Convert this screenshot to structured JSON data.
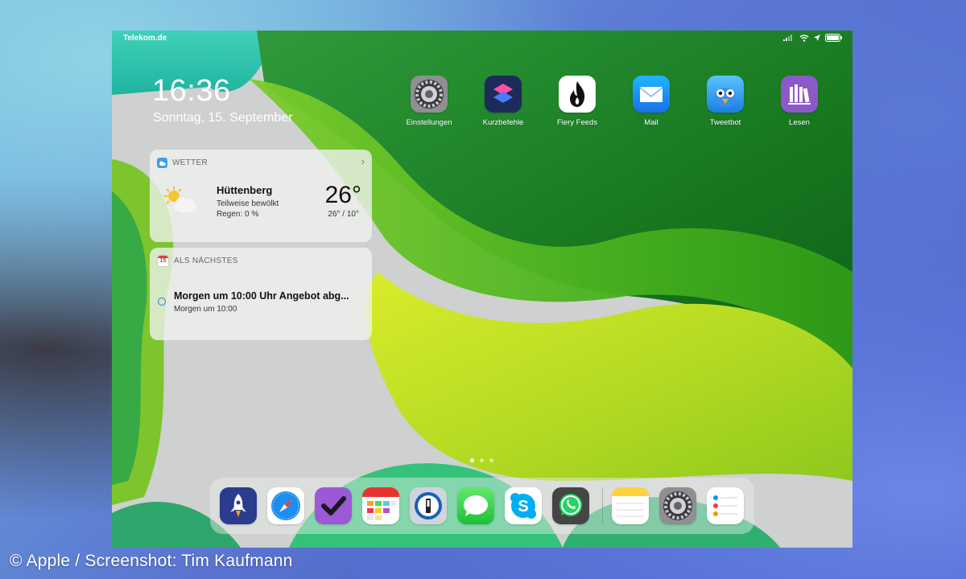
{
  "credit": "© Apple / Screenshot: Tim Kaufmann",
  "statusbar": {
    "carrier": "Telekom.de"
  },
  "lockinfo": {
    "time": "16:36",
    "date": "Sonntag, 15. September"
  },
  "weather": {
    "header": "WETTER",
    "city": "Hüttenberg",
    "condition": "Teilweise bewölkt",
    "rain": "Regen: 0 %",
    "temp": "26°",
    "range": "26° / 10°"
  },
  "upnext": {
    "header": "ALS NÄCHSTES",
    "calendar_day": "15",
    "event_title": "Morgen um 10:00 Uhr Angebot abg...",
    "event_time": "Morgen um 10:00"
  },
  "apps": [
    {
      "label": "Einstellungen",
      "icon": "settings-icon"
    },
    {
      "label": "Kurzbefehle",
      "icon": "shortcuts-icon"
    },
    {
      "label": "Fiery Feeds",
      "icon": "flame-icon"
    },
    {
      "label": "Mail",
      "icon": "mail-icon"
    },
    {
      "label": "Tweetbot",
      "icon": "tweetbot-icon"
    },
    {
      "label": "Lesen",
      "icon": "books-icon"
    }
  ],
  "dock": [
    {
      "icon": "rocket-icon"
    },
    {
      "icon": "safari-icon"
    },
    {
      "icon": "checkmark-icon"
    },
    {
      "icon": "fantastical-calendar-icon"
    },
    {
      "icon": "password-manager-icon"
    },
    {
      "icon": "messages-icon"
    },
    {
      "icon": "skype-icon"
    },
    {
      "icon": "whatsapp-icon"
    },
    {
      "icon": "notes-icon"
    },
    {
      "icon": "settings-icon"
    },
    {
      "icon": "reminders-icon"
    }
  ],
  "page_dots": {
    "count": 3,
    "active_index": 0
  }
}
